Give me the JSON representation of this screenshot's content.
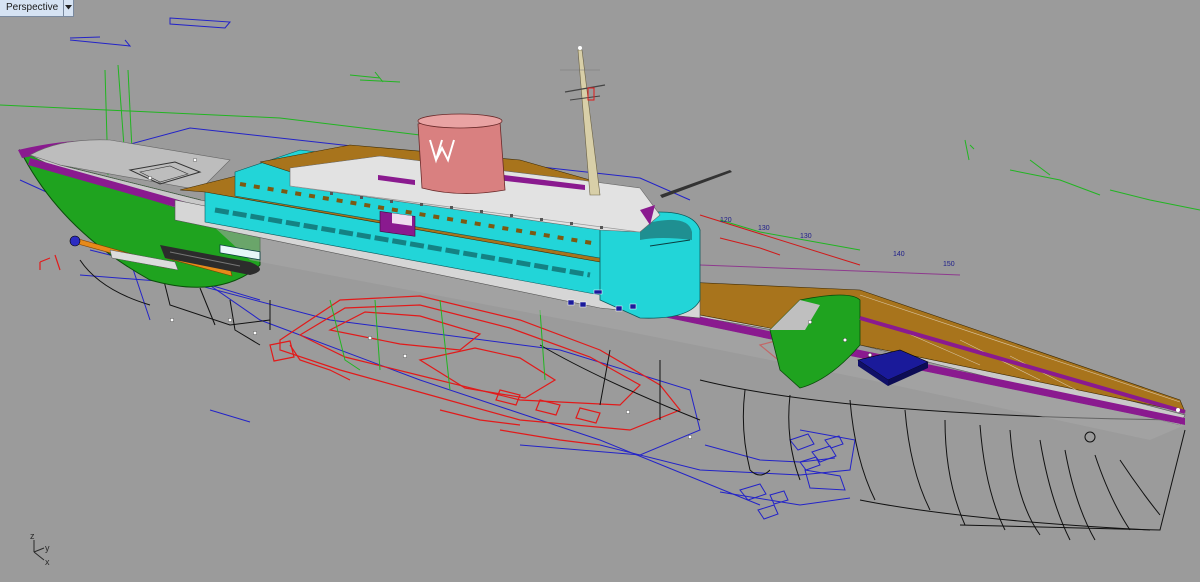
{
  "viewport": {
    "title": "Perspective",
    "menu_icon": "chevron-down-icon"
  },
  "rulers": [
    "120",
    "130",
    "130",
    "140",
    "150"
  ],
  "axes": {
    "z": "z",
    "y": "y",
    "x": "x"
  },
  "colors": {
    "background": "#9b9b9b",
    "deck": "#a8741c",
    "superstructure_cyan": "#22d5d8",
    "hull_stripe_purple": "#8a1a8f",
    "funnel": "#d98080",
    "bow_green": "#1fa31f",
    "gangway_red": "#e21a1a",
    "wire_blue": "#2323c8",
    "wire_black": "#111111"
  }
}
